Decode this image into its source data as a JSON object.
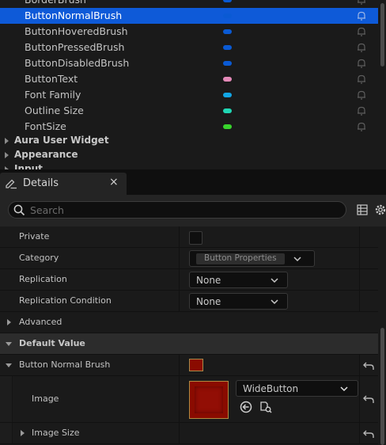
{
  "variables": {
    "items": [
      {
        "name": "BorderBrush",
        "pin_color": "#0a5ad4",
        "selected": false
      },
      {
        "name": "ButtonNormalBrush",
        "pin_color": "#0a5ad4",
        "selected": true
      },
      {
        "name": "ButtonHoveredBrush",
        "pin_color": "#0a5ad4",
        "selected": false
      },
      {
        "name": "ButtonPressedBrush",
        "pin_color": "#0a5ad4",
        "selected": false
      },
      {
        "name": "ButtonDisabledBrush",
        "pin_color": "#0a5ad4",
        "selected": false
      },
      {
        "name": "ButtonText",
        "pin_color": "#e48ab8",
        "selected": false
      },
      {
        "name": "Font Family",
        "pin_color": "#12a6e6",
        "selected": false
      },
      {
        "name": "Outline Size",
        "pin_color": "#20d6b4",
        "selected": false
      },
      {
        "name": "FontSize",
        "pin_color": "#38d42c",
        "selected": false
      }
    ],
    "groups": [
      "Aura User Widget",
      "Appearance",
      "Input"
    ]
  },
  "details": {
    "tab_label": "Details",
    "close_glyph": "×",
    "search_placeholder": "Search",
    "properties": {
      "private_label": "Private",
      "category_label": "Category",
      "category_value": "Button Properties",
      "replication_label": "Replication",
      "replication_value": "None",
      "replication_condition_label": "Replication Condition",
      "replication_condition_value": "None",
      "advanced_label": "Advanced",
      "default_value_label": "Default Value",
      "button_normal_brush_label": "Button Normal Brush",
      "button_normal_brush_color": "#8a0b00",
      "image_label": "Image",
      "image_asset": "WideButton",
      "image_size_label": "Image Size"
    }
  },
  "colors": {
    "selection": "#0e5ad8",
    "panel_bg": "#1a1a1a",
    "category_bg": "#2c2c2c"
  }
}
